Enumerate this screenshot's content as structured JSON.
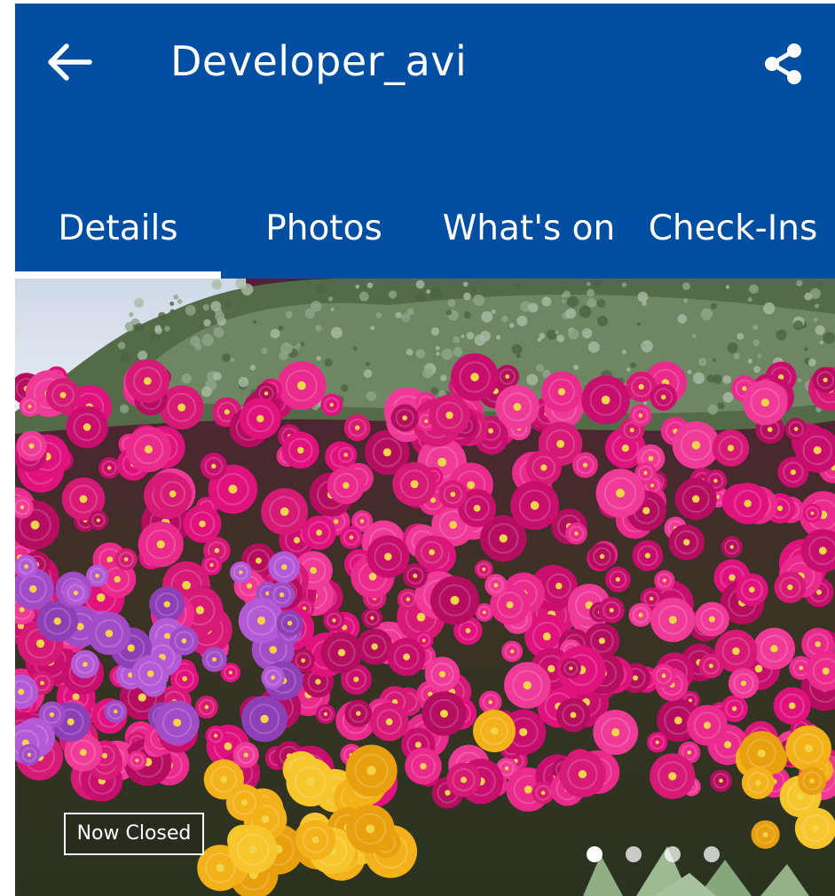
{
  "header": {
    "title": "Developer_avi",
    "back_icon": "arrow-left-icon",
    "share_icon": "share-icon",
    "background_color": "#024ea3"
  },
  "tabs": [
    {
      "label": "Details",
      "selected": true
    },
    {
      "label": "Photos",
      "selected": false
    },
    {
      "label": "What's on",
      "selected": false
    },
    {
      "label": "Check-Ins",
      "selected": false
    }
  ],
  "hero": {
    "status": "Now Closed",
    "carousel": {
      "total": 4,
      "current": 1
    }
  }
}
